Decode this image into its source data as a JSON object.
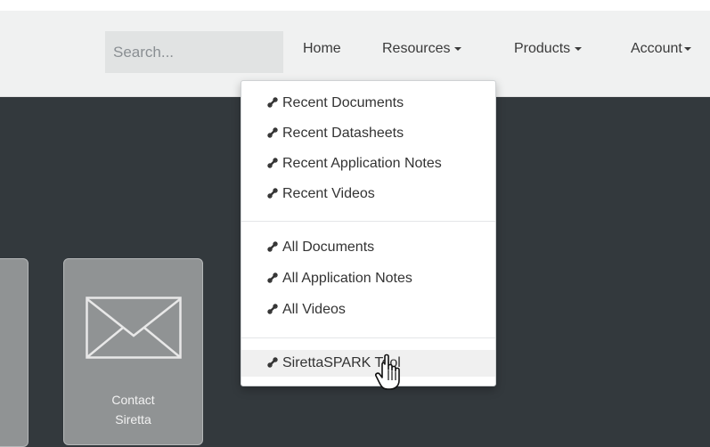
{
  "header": {
    "search": {
      "placeholder": "Search...",
      "value": ""
    },
    "nav": [
      {
        "label": "Home",
        "has_caret": false
      },
      {
        "label": "Resources",
        "has_caret": true
      },
      {
        "label": "Products",
        "has_caret": true
      },
      {
        "label": "Account",
        "has_caret": true
      }
    ]
  },
  "resources_menu": {
    "open": true,
    "groups": [
      {
        "items": [
          {
            "label": "Recent Documents",
            "icon": "link-icon"
          },
          {
            "label": "Recent Datasheets",
            "icon": "link-icon"
          },
          {
            "label": "Recent Application Notes",
            "icon": "link-icon"
          },
          {
            "label": "Recent Videos",
            "icon": "link-icon"
          }
        ]
      },
      {
        "items": [
          {
            "label": "All Documents",
            "icon": "link-icon"
          },
          {
            "label": "All Application Notes",
            "icon": "link-icon"
          },
          {
            "label": "All Videos",
            "icon": "link-icon"
          }
        ]
      },
      {
        "items": [
          {
            "label": "SirettaSPARK Tool",
            "icon": "link-icon",
            "hovered": true
          }
        ]
      }
    ]
  },
  "tiles": [
    {
      "label_line1": "",
      "label_line2": ""
    },
    {
      "label_line1": "Contact",
      "label_line2": "Siretta",
      "icon": "envelope-icon"
    }
  ],
  "colors": {
    "header_bg": "#f0f1f1",
    "search_bg": "#e1e3e3",
    "body_bg": "#33393d",
    "tile_bg": "#909394"
  }
}
